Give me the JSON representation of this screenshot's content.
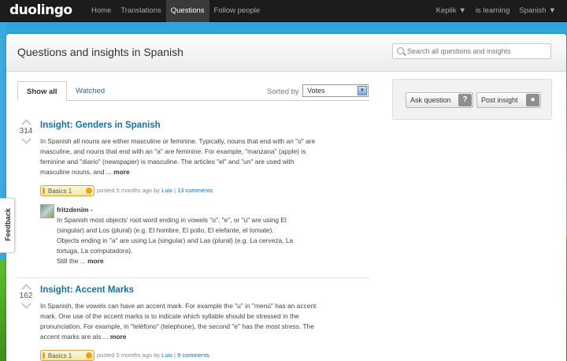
{
  "topbar": {
    "logo": "duolingo",
    "nav": [
      "Home",
      "Translations",
      "Questions",
      "Follow people"
    ],
    "active_nav": "Questions",
    "user": "Keplik",
    "learning_label": "is learning",
    "language": "Spanish"
  },
  "header": {
    "title": "Questions and insights in Spanish",
    "search_placeholder": "Search all questions and insights"
  },
  "tabs": {
    "show_all": "Show all",
    "watched": "Watched",
    "sort_label": "Sorted by",
    "sort_value": "Votes"
  },
  "sidebar": {
    "ask_label": "Ask question",
    "ask_icon": "?",
    "post_label": "Post insight"
  },
  "feedback": "Feedback",
  "questions": [
    {
      "votes": "314",
      "title": "Insight: Genders in Spanish",
      "body_lines": [
        "In Spanish all nouns are either masculine or feminine. Typically, nouns that end with an \"o\" are",
        "masculine, and nouns that end with an \"a\" are feminine. For example, \"manzana\" (apple) is",
        "feminine and \"diario\" (newspaper) is masculine. The articles \"el\" and \"un\" are used with",
        "masculine nouns, and ..."
      ],
      "more": "more",
      "skill": "Basics 1",
      "posted": "posted 5 months ago by",
      "author": "Luis",
      "separator": "|",
      "comments": "13 comments",
      "answer": {
        "user": "fritzdenim -",
        "lines": [
          "In Spanish most objects' root word ending in vowels \"o\", \"e\", or \"u\" are using El",
          "(singular) and Los (plural) (e.g. El hombre, El pollo, El elefante, el tomate).",
          "Objects ending in \"a\" are using La (singular) and Las (plural) (e.g. La cerveza, La",
          "tortuga, La computadora).",
          "Still the ..."
        ],
        "more": "more"
      }
    },
    {
      "votes": "162",
      "title": "Insight: Accent Marks",
      "body_lines": [
        "In Spanish, the vowels can have an accent mark. For example the \"u\" in \"menú\" has an accent",
        "mark. One use of the accent marks is to indicate which syllable should be stressed in the",
        "pronunciation. For example, in \"teléfono\" (telephone), the second \"e\" has the most stress. The",
        "accent marks are als ..."
      ],
      "more": "more",
      "skill": "Basics 1",
      "posted": "posted 5 months ago by",
      "author": "Luis",
      "separator": "|",
      "comments": "9 comments"
    }
  ]
}
